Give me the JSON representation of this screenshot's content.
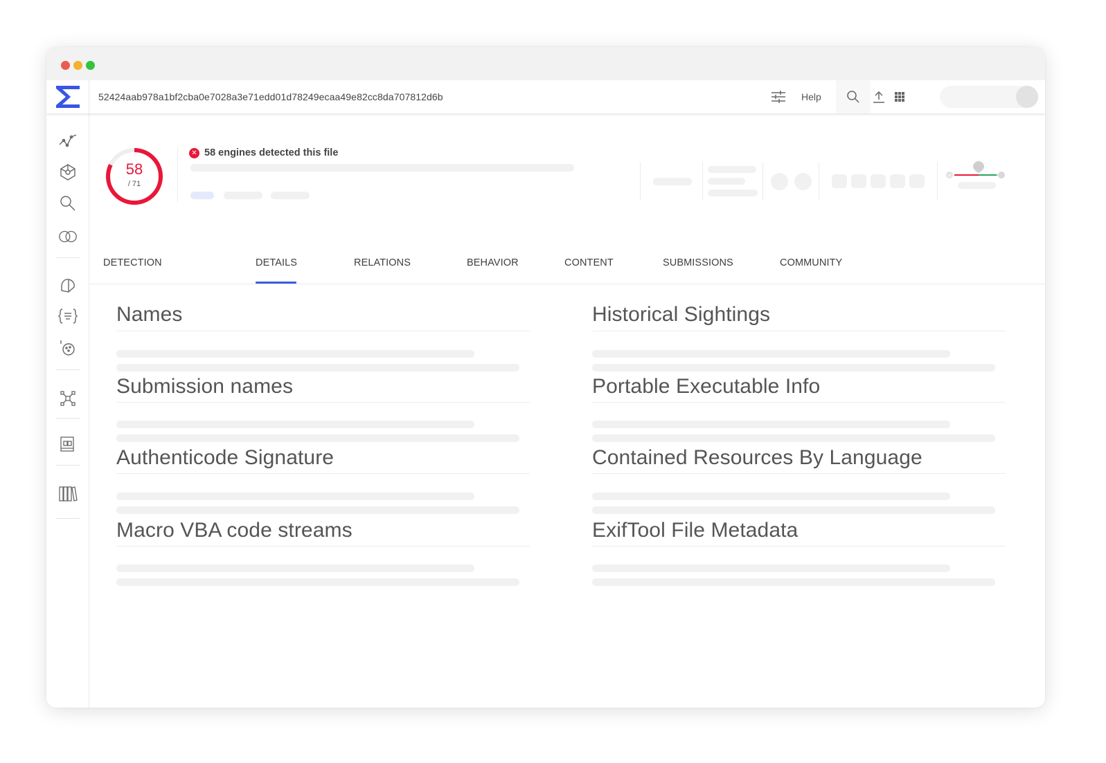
{
  "topbar": {
    "file_hash": "52424aab978a1bf2cba0e7028a3e71edd01d78249ecaa49e82cc8da707812d6b",
    "help_label": "Help",
    "icons": [
      "sigma-logo-icon",
      "filter-sliders-icon",
      "search-icon",
      "upload-icon",
      "apps-grid-icon",
      "avatar"
    ]
  },
  "sidebar": {
    "icons": [
      "trend-graph-icon",
      "network-graph-icon",
      "search-icon",
      "intersection-icon",
      "hunting-icon",
      "yara-rules-icon",
      "livehunt-icon",
      "collections-icon",
      "retrohunt-icon",
      "library-icon"
    ]
  },
  "summary": {
    "score": "58",
    "score_total": "/ 71",
    "detection_text": "58 engines detected this file",
    "accent_color": "#e8173a"
  },
  "tabs": [
    {
      "label": "DETECTION",
      "active": false
    },
    {
      "label": "DETAILS",
      "active": true
    },
    {
      "label": "RELATIONS",
      "active": false
    },
    {
      "label": "BEHAVIOR",
      "active": false
    },
    {
      "label": "CONTENT",
      "active": false
    },
    {
      "label": "SUBMISSIONS",
      "active": false
    },
    {
      "label": "COMMUNITY",
      "active": false
    }
  ],
  "sections": {
    "left": [
      "Names",
      "Submission names",
      "Authenticode Signature",
      "Macro VBA code streams"
    ],
    "right": [
      "Historical Sightings",
      "Portable Executable Info",
      "Contained Resources By Language",
      "ExifTool File Metadata"
    ]
  }
}
